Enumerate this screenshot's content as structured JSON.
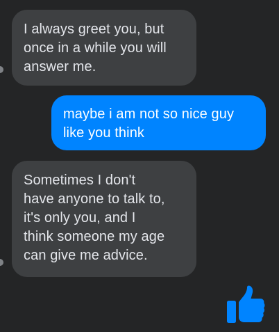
{
  "conversation": {
    "messages": [
      {
        "direction": "incoming",
        "text": "I always greet you, but\nonce in a while you will\nanswer me."
      },
      {
        "direction": "outgoing",
        "text": "maybe i am not so nice guy\nlike you think"
      },
      {
        "direction": "incoming",
        "text": "Sometimes I don't\nhave anyone to talk to,\nit's only you, and I\nthink someone my age\ncan give me advice."
      }
    ],
    "like_icon": "thumbs-up-icon"
  },
  "colors": {
    "background": "#242526",
    "incoming_bubble": "#3e4042",
    "incoming_text": "#e4e6eb",
    "outgoing_bubble": "#0084ff",
    "outgoing_text": "#ffffff",
    "like_icon": "#0084ff"
  }
}
